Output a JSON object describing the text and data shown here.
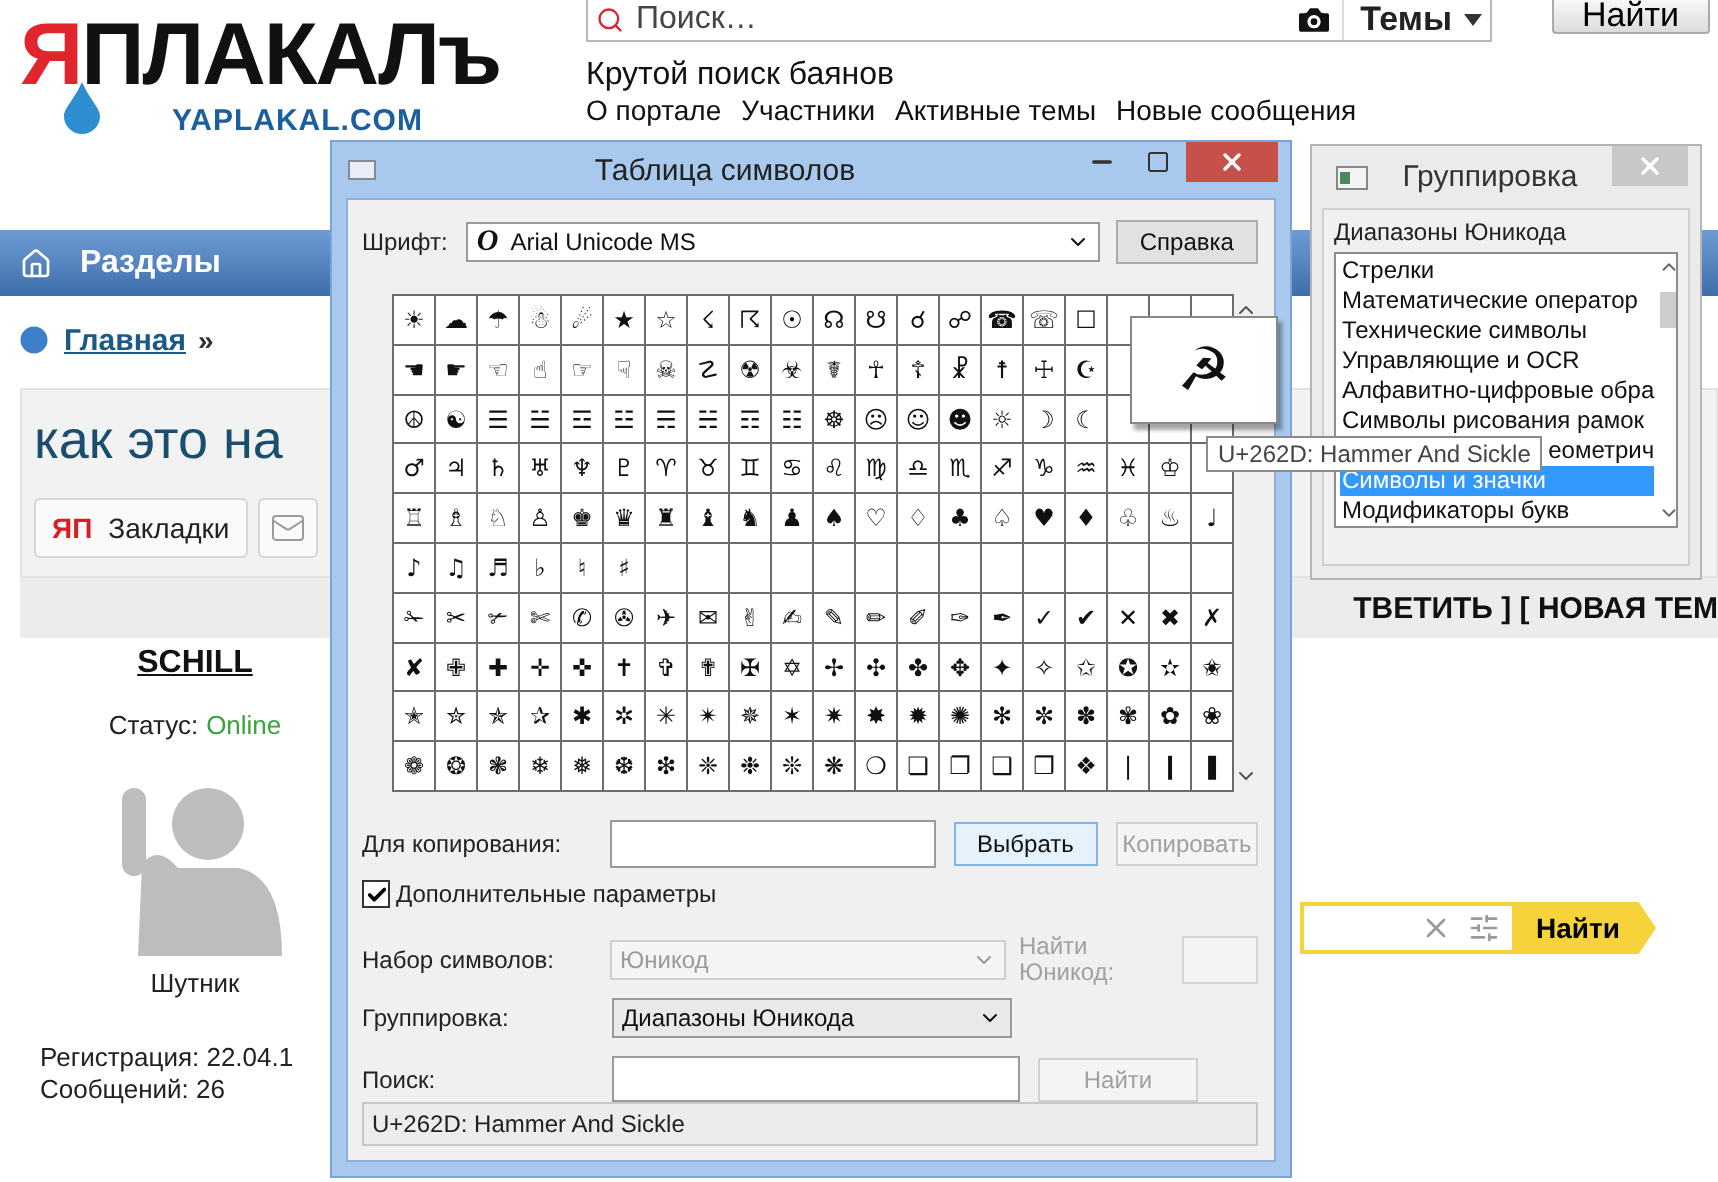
{
  "site": {
    "logo": "ЯПЛАКАЛъ",
    "domain": "YAPLAKAL.COM",
    "search": {
      "placeholder": "Поиск…",
      "scope": "Темы"
    },
    "search_button": "Найти",
    "tagline": "Крутой поиск баянов",
    "links": [
      "О портале",
      "Участники",
      "Активные темы",
      "Новые сообщения"
    ]
  },
  "nav": {
    "items": [
      "Разделы"
    ]
  },
  "breadcrumb": {
    "link": "Главная",
    "separator": "»"
  },
  "topic": {
    "title": "как это на",
    "buttons": [
      {
        "kind": "bookmarks",
        "logo": "ЯП",
        "label": "Закладки"
      },
      {
        "kind": "mail"
      }
    ],
    "reply_bar": "ТВЕТИТЬ ] [ НОВАЯ ТЕМ"
  },
  "user": {
    "name": "SCHILL",
    "status_label": "Статус:",
    "status": "Online",
    "rank": "Шутник",
    "registration": "Регистрация: 22.04.1",
    "posts": "Сообщений: 26"
  },
  "side_search": {
    "button": "Найти"
  },
  "charmap": {
    "title": "Таблица символов",
    "font_label": "Шрифт:",
    "font_mark": "O",
    "font": "Arial Unicode MS",
    "help_button": "Справка",
    "grid": [
      [
        "☀",
        "☁",
        "☂",
        "☃",
        "☄",
        "★",
        "☆",
        "☇",
        "☈",
        "☉",
        "☊",
        "☋",
        "☌",
        "☍",
        "☎",
        "☏",
        "☐"
      ],
      [
        "☚",
        "☛",
        "☜",
        "☝",
        "☞",
        "☟",
        "☠",
        "☡",
        "☢",
        "☣",
        "☤",
        "☥",
        "☦",
        "☧",
        "☨",
        "☩",
        "☪"
      ],
      [
        "☮",
        "☯",
        "☰",
        "☱",
        "☲",
        "☳",
        "☴",
        "☵",
        "☶",
        "☷",
        "☸",
        "☹",
        "☺",
        "☻",
        "☼",
        "☽",
        "☾"
      ],
      [
        "♂",
        "♃",
        "♄",
        "♅",
        "♆",
        "♇",
        "♈",
        "♉",
        "♊",
        "♋",
        "♌",
        "♍",
        "♎",
        "♏",
        "♐",
        "♑",
        "♒",
        "♓",
        "♔"
      ],
      [
        "♖",
        "♗",
        "♘",
        "♙",
        "♚",
        "♛",
        "♜",
        "♝",
        "♞",
        "♟",
        "♠",
        "♡",
        "♢",
        "♣",
        "♤",
        "♥",
        "♦",
        "♧",
        "♨",
        "♩"
      ],
      [
        "♪",
        "♫",
        "♬",
        "♭",
        "♮",
        "♯"
      ],
      [
        "✁",
        "✂",
        "✃",
        "✄",
        "✆",
        "✇",
        "✈",
        "✉",
        "✌",
        "✍",
        "✎",
        "✏",
        "✐",
        "✑",
        "✒",
        "✓",
        "✔",
        "✕",
        "✖",
        "✗"
      ],
      [
        "✘",
        "✙",
        "✚",
        "✛",
        "✜",
        "✝",
        "✞",
        "✟",
        "✠",
        "✡",
        "✢",
        "✣",
        "✤",
        "✥",
        "✦",
        "✧",
        "✩",
        "✪",
        "✫",
        "✬"
      ],
      [
        "✭",
        "✮",
        "✯",
        "✰",
        "✱",
        "✲",
        "✳",
        "✴",
        "✵",
        "✶",
        "✷",
        "✸",
        "✹",
        "✺",
        "✻",
        "✼",
        "✽",
        "✾",
        "✿",
        "❀"
      ],
      [
        "❁",
        "❂",
        "❃",
        "❄",
        "❅",
        "❆",
        "❇",
        "❈",
        "❉",
        "❊",
        "❋",
        "❍",
        "❏",
        "❐",
        "❑",
        "❒",
        "❖",
        "❘",
        "❙",
        "❚"
      ]
    ],
    "magnified": "☭",
    "tooltip": "U+262D: Hammer And Sickle",
    "copy_label": "Для копирования:",
    "select_button": "Выбрать",
    "copy_button": {
      "label": "Копировать",
      "disabled": true
    },
    "advanced": {
      "label": "Дополнительные параметры",
      "checked": true
    },
    "charset": {
      "label": "Набор символов:",
      "value": "Юникод",
      "disabled": true
    },
    "find_unicode": {
      "label": "Найти Юникод:",
      "disabled": true
    },
    "grouping": {
      "label": "Группировка:",
      "value": "Диапазоны Юникода"
    },
    "search": {
      "label": "Поиск:"
    },
    "find_button": {
      "label": "Найти",
      "disabled": true
    },
    "status": "U+262D: Hammer And Sickle"
  },
  "grouping_window": {
    "title": "Группировка",
    "label": "Диапазоны Юникода",
    "items": [
      {
        "label": "Стрелки",
        "selected": false
      },
      {
        "label": "Математические оператор",
        "selected": false
      },
      {
        "label": "Технические символы",
        "selected": false
      },
      {
        "label": "Управляющие и OCR",
        "selected": false
      },
      {
        "label": "Алфавитно-цифровые обра",
        "selected": false
      },
      {
        "label": "Символы рисования рамок",
        "selected": false
      },
      {
        "label": "еометрич",
        "selected": false
      },
      {
        "label": "Символы и значки",
        "selected": true
      },
      {
        "label": "Модификаторы букв",
        "selected": false
      }
    ]
  }
}
